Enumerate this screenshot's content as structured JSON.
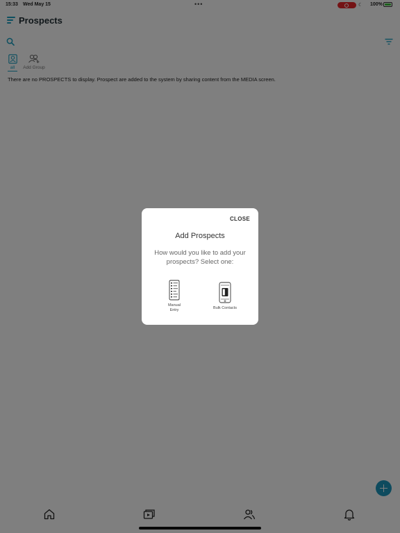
{
  "status_bar": {
    "time": "15:33",
    "date": "Wed May 15",
    "dots": "•••",
    "battery_text": "100%",
    "icons": "☾",
    "battery_color": "#3ac33a",
    "record_color": "#e8262a"
  },
  "header": {
    "title": "Prospects",
    "menu_icon": "menu-icon"
  },
  "toolbar": {
    "search_icon": "search-icon",
    "filter_icon": "filter-icon"
  },
  "tabs": [
    {
      "label": "all",
      "icon": "person-card-icon",
      "active": true
    },
    {
      "label": "Add Group",
      "icon": "group-add-icon",
      "active": false
    }
  ],
  "empty_message": "There are no PROSPECTS to display. Prospect are added to the system by sharing content from the MEDIA screen.",
  "modal": {
    "close_label": "CLOSE",
    "title": "Add Prospects",
    "subtitle": "How would you like to add your prospects? Select one:",
    "options": [
      {
        "label": "Manual Entry",
        "label_line1": "Manual",
        "label_line2": "Entry",
        "icon": "manual-entry-icon"
      },
      {
        "label": "Bulk Contacts",
        "icon": "bulk-contacts-icon"
      }
    ]
  },
  "bottom_nav": [
    {
      "icon": "home-icon"
    },
    {
      "icon": "media-icon"
    },
    {
      "icon": "people-icon"
    },
    {
      "icon": "bell-icon"
    }
  ],
  "fab": {
    "icon": "plus-icon",
    "color": "#1d97bd"
  },
  "accent_color": "#1a9fc0"
}
